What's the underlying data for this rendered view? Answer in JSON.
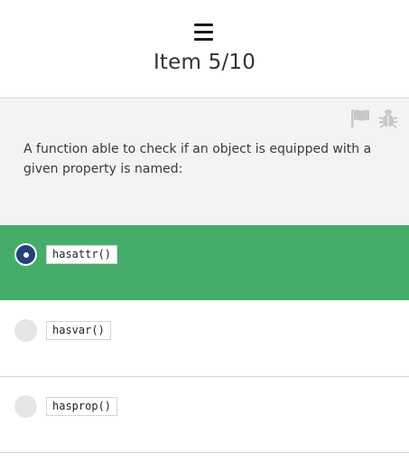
{
  "header": {
    "menu_icon": "hamburger-menu-icon",
    "title": "Item 5/10"
  },
  "question": {
    "flag_icon": "flag-icon",
    "bug_icon": "bug-icon",
    "text": "A function able to check if an object is equipped with a given property is named:"
  },
  "options": [
    {
      "label": "hasattr()",
      "selected": true
    },
    {
      "label": "hasvar()",
      "selected": false
    },
    {
      "label": "hasprop()",
      "selected": false
    }
  ],
  "colors": {
    "selected_bg": "#45ad6a",
    "radio_checked": "#23417a",
    "question_bg": "#f3f3f3",
    "icon_muted": "#c8c8c8"
  }
}
